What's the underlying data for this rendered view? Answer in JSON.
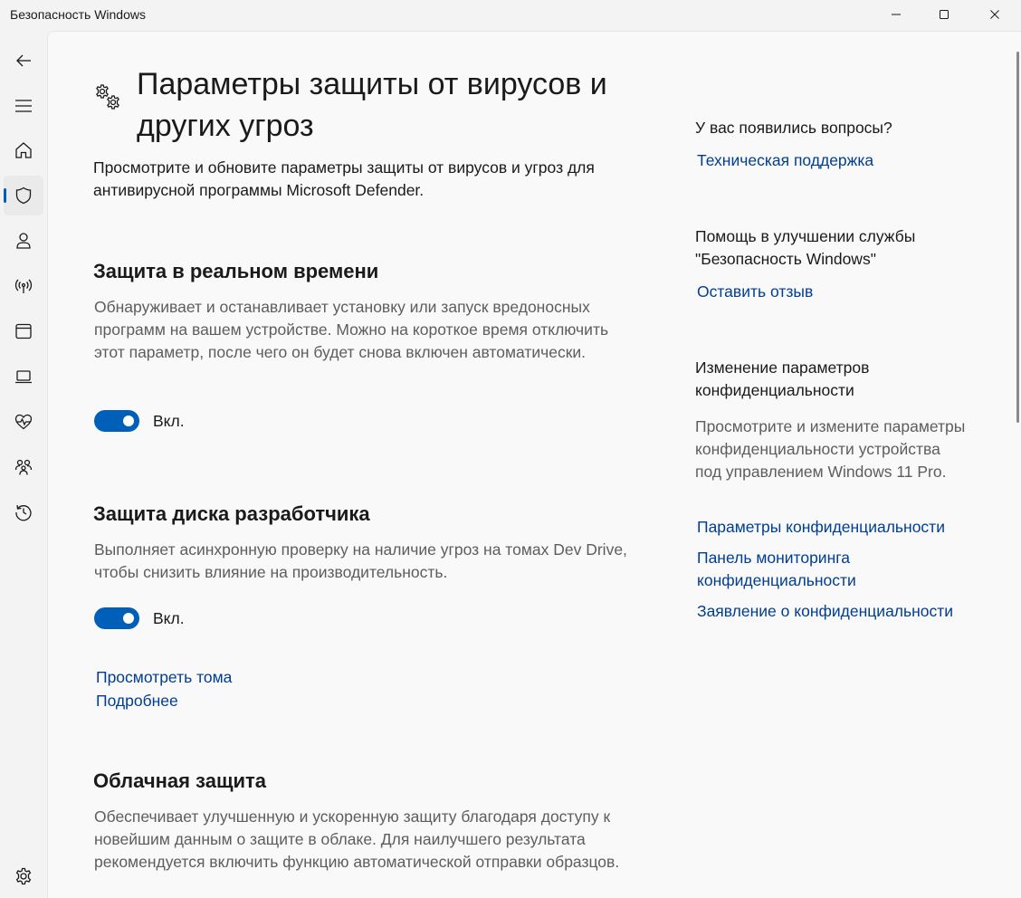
{
  "window": {
    "title": "Безопасность Windows"
  },
  "nav": {
    "items": [
      {
        "icon": "back-arrow-icon"
      },
      {
        "icon": "hamburger-menu-icon"
      },
      {
        "icon": "home-icon"
      },
      {
        "icon": "shield-icon",
        "active": true
      },
      {
        "icon": "person-icon"
      },
      {
        "icon": "network-antenna-icon"
      },
      {
        "icon": "app-browser-icon"
      },
      {
        "icon": "laptop-icon"
      },
      {
        "icon": "heart-pulse-icon"
      },
      {
        "icon": "family-icon"
      },
      {
        "icon": "history-icon"
      },
      {
        "icon": "settings-gear-icon"
      }
    ]
  },
  "page": {
    "title": "Параметры защиты от вирусов и других угроз",
    "description": "Просмотрите и обновите параметры защиты от вирусов и угроз для антивирусной программы Microsoft Defender."
  },
  "sections": {
    "realtime": {
      "title": "Защита в реальном времени",
      "description": "Обнаруживает и останавливает установку или запуск вредоносных программ на вашем устройстве. Можно на короткое время отключить этот параметр, после чего он будет снова включен автоматически.",
      "toggle_label": "Вкл.",
      "toggle_on": true
    },
    "devdrive": {
      "title": "Защита диска разработчика",
      "description": "Выполняет асинхронную проверку на наличие угроз на томах Dev Drive, чтобы снизить влияние на производительность.",
      "toggle_label": "Вкл.",
      "toggle_on": true,
      "link_volumes": "Просмотреть тома",
      "link_more": "Подробнее"
    },
    "cloud": {
      "title": "Облачная защита",
      "description": "Обеспечивает улучшенную и ускоренную защиту благодаря доступу к новейшим данным о защите в облаке. Для наилучшего результата рекомендуется включить функцию автоматической отправки образцов."
    }
  },
  "sidebar": {
    "questions_heading": "У вас появились вопросы?",
    "support_link": "Техническая поддержка",
    "improve_heading": "Помощь в улучшении службы \"Безопасность Windows\"",
    "feedback_link": "Оставить отзыв",
    "privacy_heading": "Изменение параметров конфиденциальности",
    "privacy_text": "Просмотрите и измените параметры конфиденциальности устройства под управлением Windows 11 Pro.",
    "privacy_settings_link": "Параметры конфиденциальности",
    "privacy_dashboard_link": "Панель мониторинга конфиденциальности",
    "privacy_statement_link": "Заявление о конфиденциальности"
  },
  "colors": {
    "accent": "#005fb8",
    "link": "#003e92",
    "secondary_text": "#5d5d5d"
  }
}
